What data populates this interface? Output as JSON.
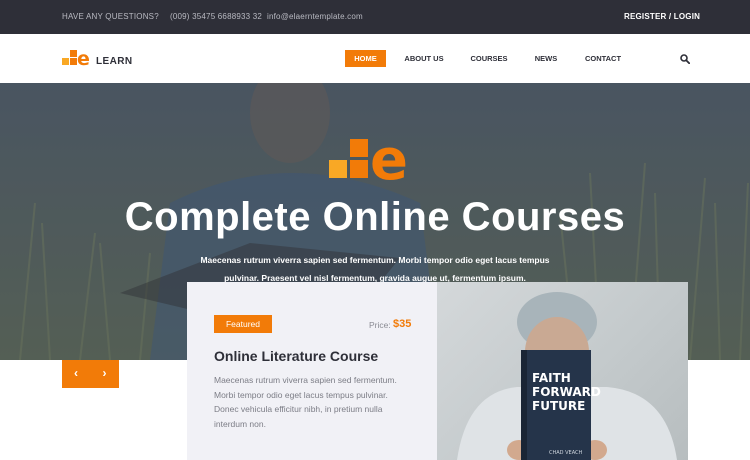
{
  "topbar": {
    "question": "HAVE ANY QUESTIONS?",
    "phone": "(009) 35475 6688933 32",
    "email": "info@elaerntemplate.com",
    "register_login": "REGISTER / LOGIN"
  },
  "brand": {
    "logo_letter": "e",
    "logo_text": "LEARN",
    "accent_color": "#f27b08",
    "accent_secondary": "#f9a825",
    "dark_color": "#2e2f38"
  },
  "nav": {
    "items": [
      "HOME",
      "ABOUT US",
      "COURSES",
      "NEWS",
      "CONTACT"
    ],
    "active": "HOME",
    "search_icon": "search-icon"
  },
  "hero": {
    "title": "Complete Online Courses",
    "subtitle_line1": "Maecenas rutrum viverra sapien sed fermentum. Morbi tempor odio eget lacus tempus",
    "subtitle_line2": "pulvinar. Praesent vel nisl fermentum, gravida augue ut, fermentum ipsum."
  },
  "slider": {
    "prev_label": "‹",
    "next_label": "›"
  },
  "course_card": {
    "badge": "Featured",
    "price_label": "Price:",
    "price_value": "$35",
    "title": "Online Literature Course",
    "desc_line1": "Maecenas rutrum viverra sapien sed fermentum.",
    "desc_line2": "Morbi tempor odio eget lacus tempus pulvinar.",
    "desc_line3": "Donec vehicula efficitur nibh, in pretium nulla",
    "desc_line4": "interdum non."
  },
  "book_cover": {
    "line1": "FAITH",
    "line2": "FORWARD",
    "line3": "FUTURE",
    "author": "CHAD VEACH"
  }
}
